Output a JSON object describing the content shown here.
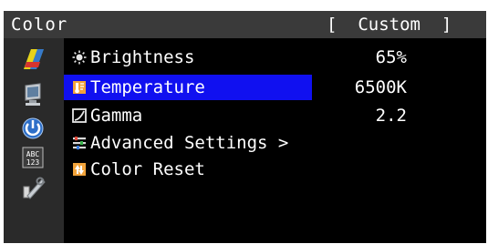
{
  "header": {
    "title": "Color",
    "mode": "[  Custom  ]"
  },
  "sidebar": {
    "icons": [
      "color-menu-icon",
      "monitor-menu-icon",
      "power-menu-icon",
      "language-menu-icon",
      "tools-menu-icon"
    ],
    "selected": "color-menu-icon"
  },
  "menu": {
    "selected_index": 1,
    "items": [
      {
        "icon": "brightness-icon",
        "label": "Brightness",
        "value": "65%"
      },
      {
        "icon": "temperature-icon",
        "label": "Temperature",
        "value": "6500K"
      },
      {
        "icon": "gamma-icon",
        "label": "Gamma",
        "value": "2.2"
      },
      {
        "icon": "advanced-settings-icon",
        "label": "Advanced Settings >",
        "value": ""
      },
      {
        "icon": "color-reset-icon",
        "label": "Color Reset",
        "value": ""
      }
    ]
  },
  "colors": {
    "highlight": "#1010f0",
    "background": "#000000",
    "titlebar": "#3a3a3a",
    "sidebar": "#2a2a2a",
    "text": "#ffffff"
  }
}
